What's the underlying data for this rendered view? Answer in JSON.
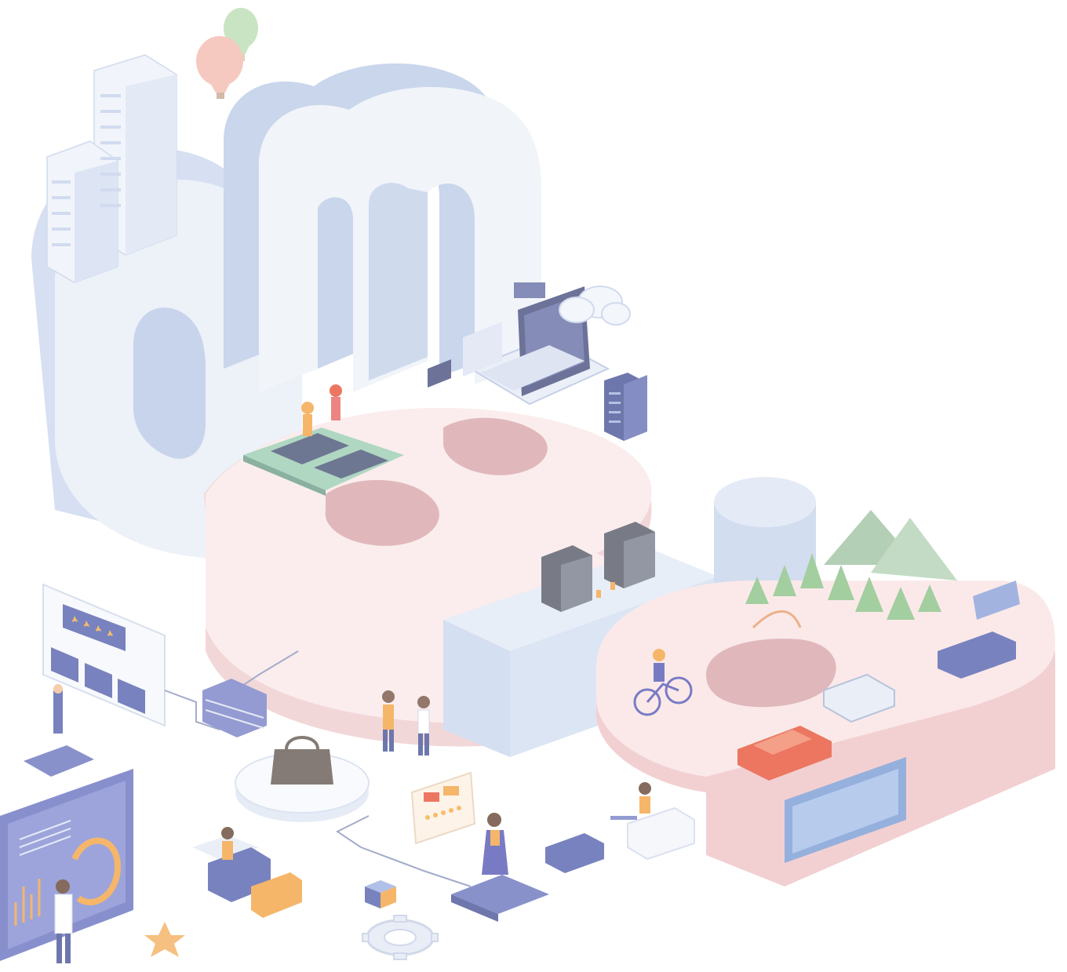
{
  "illustration": {
    "letters": [
      "o",
      "m",
      "3",
      "a"
    ],
    "rating_card": {
      "stars": 5,
      "lines": 2
    },
    "review_card": {
      "stars": 5,
      "tags": 3
    },
    "colors": {
      "o_face": "#e9eef7",
      "o_side": "#c7d4ec",
      "m_face": "#eef2f8",
      "m_side": "#bdcde8",
      "three_face": "#fbe9e9",
      "three_side": "#efcfd1",
      "three_hole": "#d9a9ad",
      "counter_face": "#e3ebf7",
      "counter_side": "#cbd8ee",
      "a_face": "#fbe4e4",
      "a_side": "#efc6c8",
      "accent_purple": "#5b5fb8",
      "accent_orange": "#f3a64a",
      "accent_red": "#e8583e",
      "tree_green": "#8fc48c"
    },
    "icons": [
      "hot-air-balloon-icon",
      "skyscraper-icon",
      "cloud-icon",
      "laptop-icon",
      "server-icon",
      "treadmill-icon",
      "coffee-machine-icon",
      "tree-icon",
      "bicycle-icon",
      "car-icon",
      "handbag-icon",
      "star-icon",
      "gear-icon",
      "chart-panel-icon"
    ]
  }
}
